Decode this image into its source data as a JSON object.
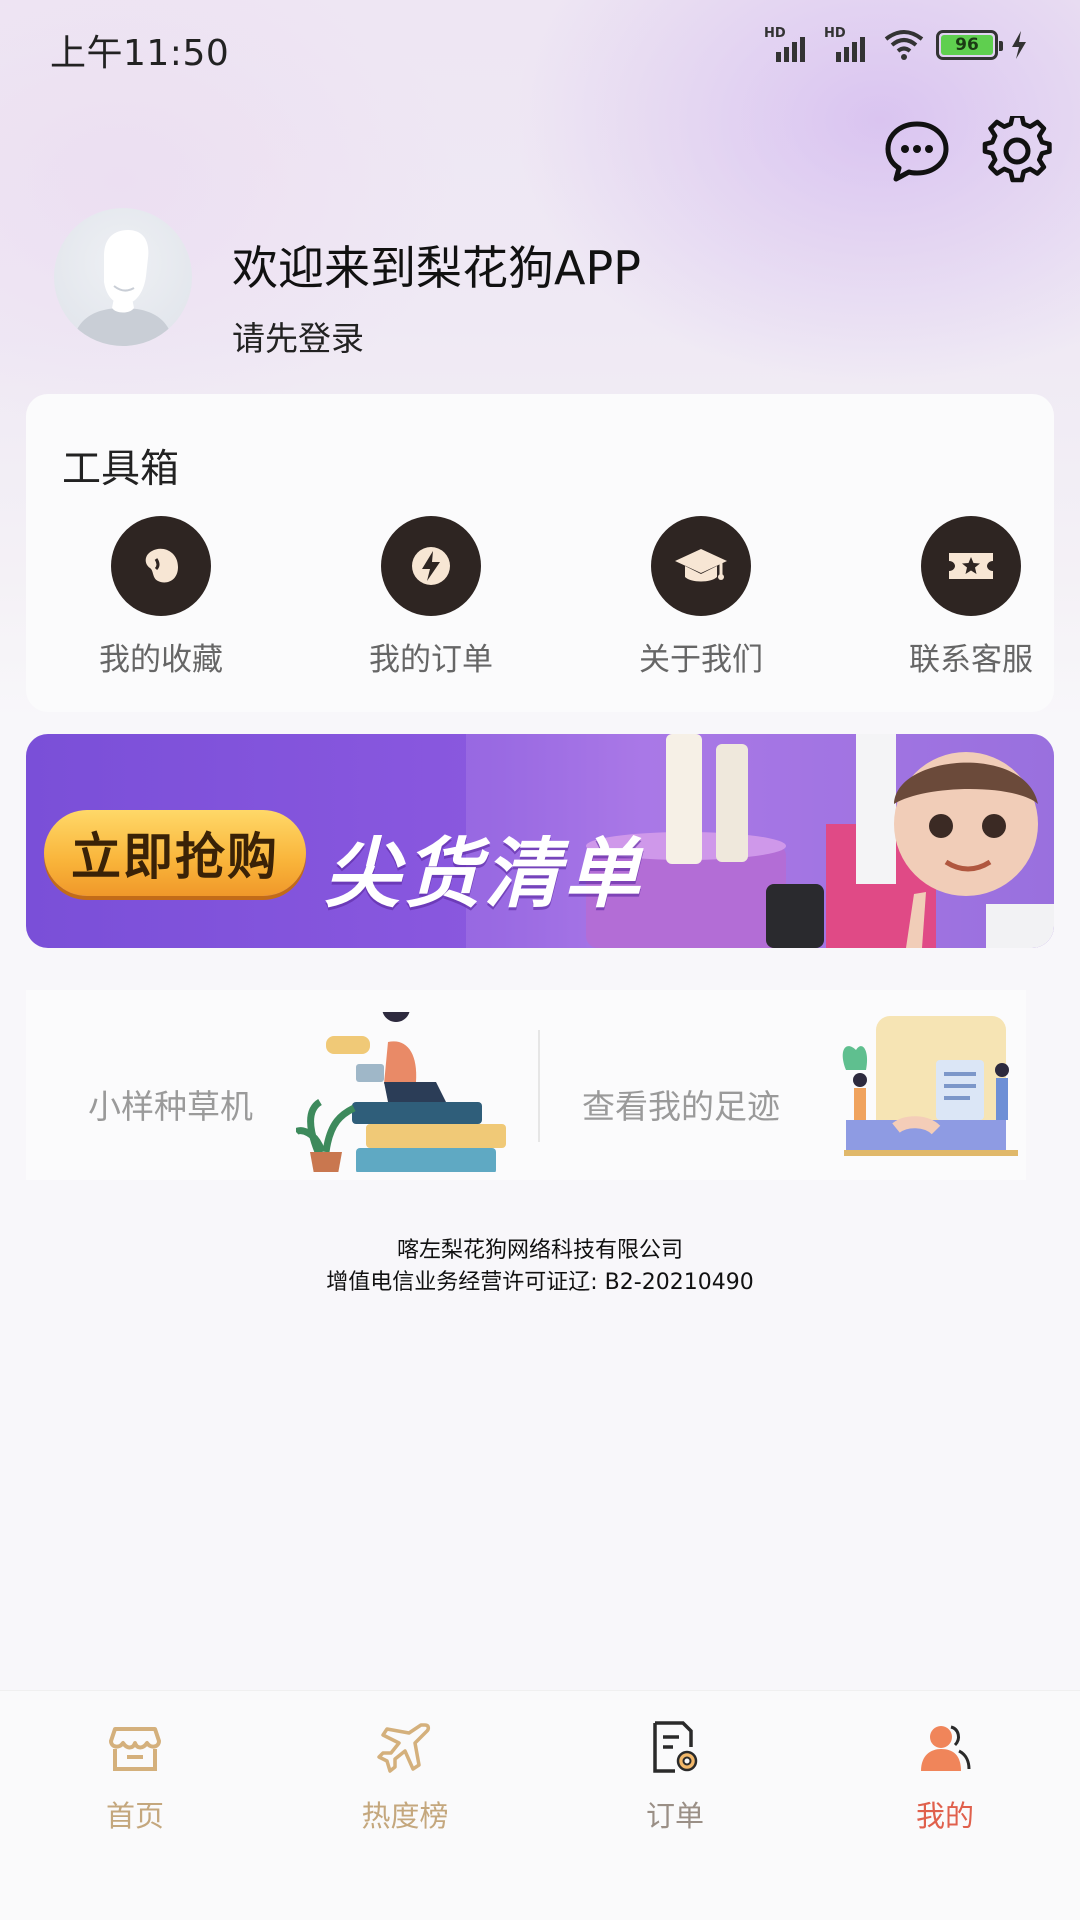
{
  "status_bar": {
    "time": "上午11:50",
    "signal1": "HD",
    "signal2": "HD",
    "battery": "96"
  },
  "header": {
    "message_icon": "chat-bubble-icon",
    "settings_icon": "gear-icon"
  },
  "profile": {
    "welcome": "欢迎来到梨花狗APP",
    "login_hint": "请先登录"
  },
  "toolbox": {
    "title": "工具箱",
    "items": [
      {
        "label": "我的收藏",
        "icon": "bean-icon"
      },
      {
        "label": "我的订单",
        "icon": "lightning-icon"
      },
      {
        "label": "关于我们",
        "icon": "graduation-cap-icon"
      },
      {
        "label": "联系客服",
        "icon": "ticket-star-icon"
      }
    ]
  },
  "banner": {
    "button": "立即抢购",
    "title": "尖货清单"
  },
  "features": [
    {
      "label": "小样种草机"
    },
    {
      "label": "查看我的足迹"
    }
  ],
  "footer": {
    "company": "喀左梨花狗网络科技有限公司",
    "license": "增值电信业务经营许可证辽:  B2-20210490"
  },
  "tabbar": {
    "items": [
      {
        "label": "首页",
        "icon": "store-icon"
      },
      {
        "label": "热度榜",
        "icon": "airplane-icon"
      },
      {
        "label": "订单",
        "icon": "document-gear-icon"
      },
      {
        "label": "我的",
        "icon": "user-icon"
      }
    ],
    "active_color": "#e0604c",
    "inactive_color": "#c4a77d"
  }
}
